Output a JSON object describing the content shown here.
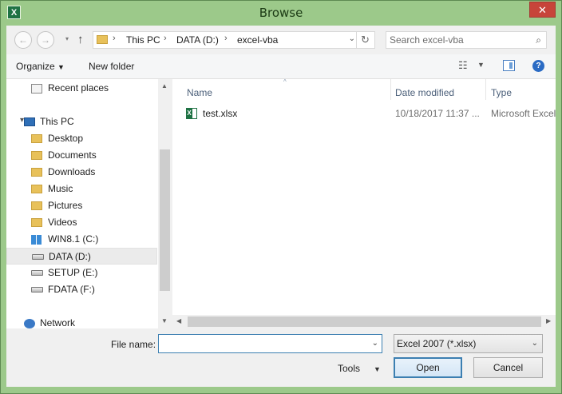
{
  "window": {
    "title": "Browse",
    "app_icon": "excel-icon",
    "close_glyph": "✕"
  },
  "nav": {
    "back_glyph": "←",
    "forward_glyph": "→",
    "up_glyph": "↑",
    "refresh_glyph": "↻"
  },
  "address": {
    "crumbs": [
      "This PC",
      "DATA (D:)",
      "excel-vba"
    ],
    "separator": "›"
  },
  "search": {
    "placeholder": "Search excel-vba"
  },
  "toolbar": {
    "organize_label": "Organize",
    "new_folder_label": "New folder",
    "help_glyph": "?"
  },
  "navpane": {
    "items": [
      {
        "label": "Recent places",
        "icon": "recent-places-icon"
      },
      {
        "label": "This PC",
        "icon": "computer-icon"
      },
      {
        "label": "Desktop",
        "icon": "folder-icon"
      },
      {
        "label": "Documents",
        "icon": "folder-icon"
      },
      {
        "label": "Downloads",
        "icon": "folder-icon"
      },
      {
        "label": "Music",
        "icon": "folder-icon"
      },
      {
        "label": "Pictures",
        "icon": "folder-icon"
      },
      {
        "label": "Videos",
        "icon": "folder-icon"
      },
      {
        "label": "WIN8.1 (C:)",
        "icon": "windows-drive-icon"
      },
      {
        "label": "DATA (D:)",
        "icon": "drive-icon",
        "selected": true
      },
      {
        "label": "SETUP (E:)",
        "icon": "drive-icon"
      },
      {
        "label": "FDATA (F:)",
        "icon": "drive-icon"
      },
      {
        "label": "Network",
        "icon": "network-icon"
      }
    ]
  },
  "files": {
    "columns": [
      "Name",
      "Date modified",
      "Type"
    ],
    "rows": [
      {
        "name": "test.xlsx",
        "date": "10/18/2017 11:37 ...",
        "type": "Microsoft Excel"
      }
    ]
  },
  "bottom": {
    "file_name_label": "File name:",
    "file_name_value": "",
    "file_type_value": "Excel 2007 (*.xlsx)",
    "tools_label": "Tools",
    "open_label": "Open",
    "cancel_label": "Cancel"
  },
  "colors": {
    "frame": "#9cc98a",
    "close": "#c7443a",
    "accent": "#3c7fb1"
  }
}
